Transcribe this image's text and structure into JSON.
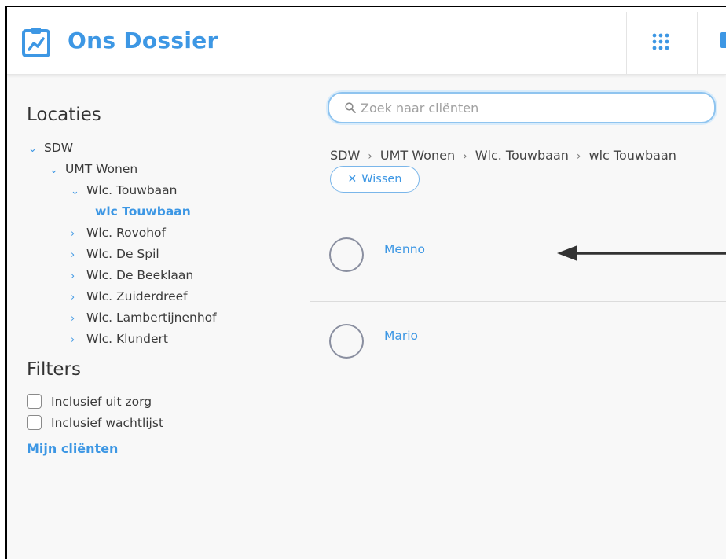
{
  "header": {
    "title": "Ons Dossier",
    "logo_icon": "clipboard-chart-icon",
    "apps_icon": "grid-apps-icon",
    "brand_color": "#3d97e4"
  },
  "sidebar": {
    "locations_heading": "Locaties",
    "tree": [
      {
        "label": "SDW",
        "state": "expanded"
      },
      {
        "label": "UMT Wonen",
        "state": "expanded"
      },
      {
        "label": "Wlc. Touwbaan",
        "state": "expanded"
      },
      {
        "label": "wlc Touwbaan",
        "state": "selected"
      },
      {
        "label": "Wlc. Rovohof",
        "state": "collapsed"
      },
      {
        "label": "Wlc. De Spil",
        "state": "collapsed"
      },
      {
        "label": "Wlc. De Beeklaan",
        "state": "collapsed"
      },
      {
        "label": "Wlc. Zuiderdreef",
        "state": "collapsed"
      },
      {
        "label": "Wlc. Lambertijnenhof",
        "state": "collapsed"
      },
      {
        "label": "Wlc. Klundert",
        "state": "collapsed"
      }
    ],
    "filters_heading": "Filters",
    "filters": [
      {
        "label": "Inclusief uit zorg",
        "checked": false
      },
      {
        "label": "Inclusief wachtlijst",
        "checked": false
      }
    ],
    "my_clients_link": "Mijn cliënten"
  },
  "main": {
    "search": {
      "placeholder": "Zoek naar cliënten",
      "value": ""
    },
    "breadcrumb": [
      "SDW",
      "UMT Wonen",
      "Wlc. Touwbaan",
      "wlc Touwbaan"
    ],
    "clear_button": "Wissen",
    "clients": [
      {
        "name": "Menno"
      },
      {
        "name": "Mario"
      }
    ]
  }
}
